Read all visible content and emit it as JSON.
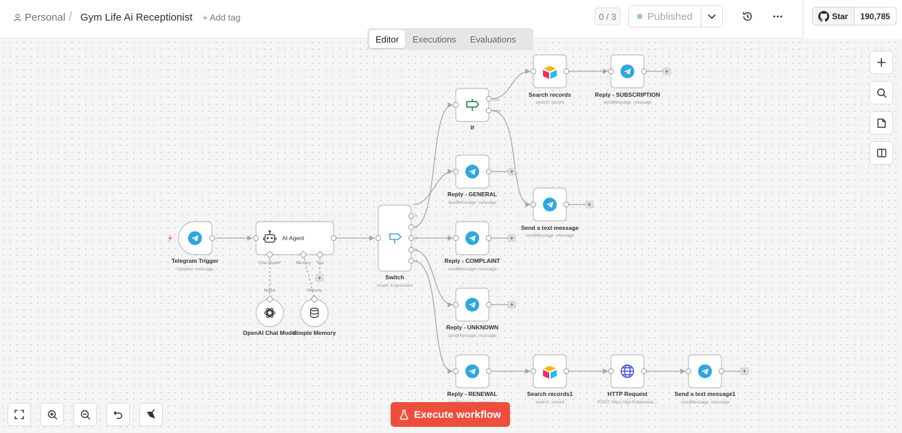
{
  "header": {
    "breadcrumb_project": "Personal",
    "breadcrumb_separator": "/",
    "workflow_name": "Gym Life Ai Receptionist",
    "add_tag": "+ Add tag",
    "counter": "0 / 3",
    "status": "Published"
  },
  "github": {
    "star_label": "Star",
    "star_count": "190,785"
  },
  "tabs": [
    "Editor",
    "Executions",
    "Evaluations"
  ],
  "active_tab": "Editor",
  "execute_button": "Execute workflow",
  "nodes": {
    "telegram_trigger": {
      "name": "Telegram Trigger",
      "sub": "Updates: message"
    },
    "ai_agent": {
      "name": "AI Agent",
      "port_chat": "Chat Model",
      "port_chat_req": "*",
      "port_memory": "Memory",
      "port_tool": "Tool"
    },
    "openai": {
      "name": "OpenAI Chat Model",
      "port": "Model"
    },
    "memory": {
      "name": "Simple Memory",
      "port": "Memory"
    },
    "switch": {
      "name": "Switch",
      "sub": "mode: Expression",
      "outputs": [
        "0",
        "1",
        "2",
        "3",
        "4"
      ]
    },
    "if": {
      "name": "If",
      "out_true": "true",
      "out_false": "false"
    },
    "search_records": {
      "name": "Search records",
      "sub": "search: record"
    },
    "reply_subscription": {
      "name": "Reply - SUBSCRIPTION",
      "sub": "sendMessage: message"
    },
    "reply_general": {
      "name": "Reply - GENERAL",
      "sub": "sendMessage: message"
    },
    "send_text": {
      "name": "Send a text message",
      "sub": "sendMessage: message"
    },
    "reply_complaint": {
      "name": "Reply - COMPLAINT",
      "sub": "sendMessage: message"
    },
    "reply_unknown": {
      "name": "Reply - UNKNOWN",
      "sub": "sendMessage: message"
    },
    "reply_renewal": {
      "name": "Reply - RENEWAL",
      "sub": "sendMessage: message"
    },
    "search_records1": {
      "name": "Search records1",
      "sub": "search: record"
    },
    "http_request": {
      "name": "HTTP Request",
      "sub": "POST: https://api.flutterwave..."
    },
    "send_text1": {
      "name": "Send a text message1",
      "sub": "sendMessage: message"
    }
  },
  "colors": {
    "accent": "#ee4f3d",
    "telegram": "#2ea6e0",
    "published_dot": "#89d6a8",
    "if_green": "#2e8b57",
    "switch_blue": "#4a9fd5",
    "trigger_bolt": "#ff6b5a"
  },
  "icons": {
    "telegram": "telegram-icon",
    "airtable": "airtable-icon",
    "http": "globe-icon",
    "openai": "openai-icon",
    "memory": "database-icon",
    "agent": "robot-icon",
    "switch": "switch-icon",
    "if": "signpost-icon"
  }
}
